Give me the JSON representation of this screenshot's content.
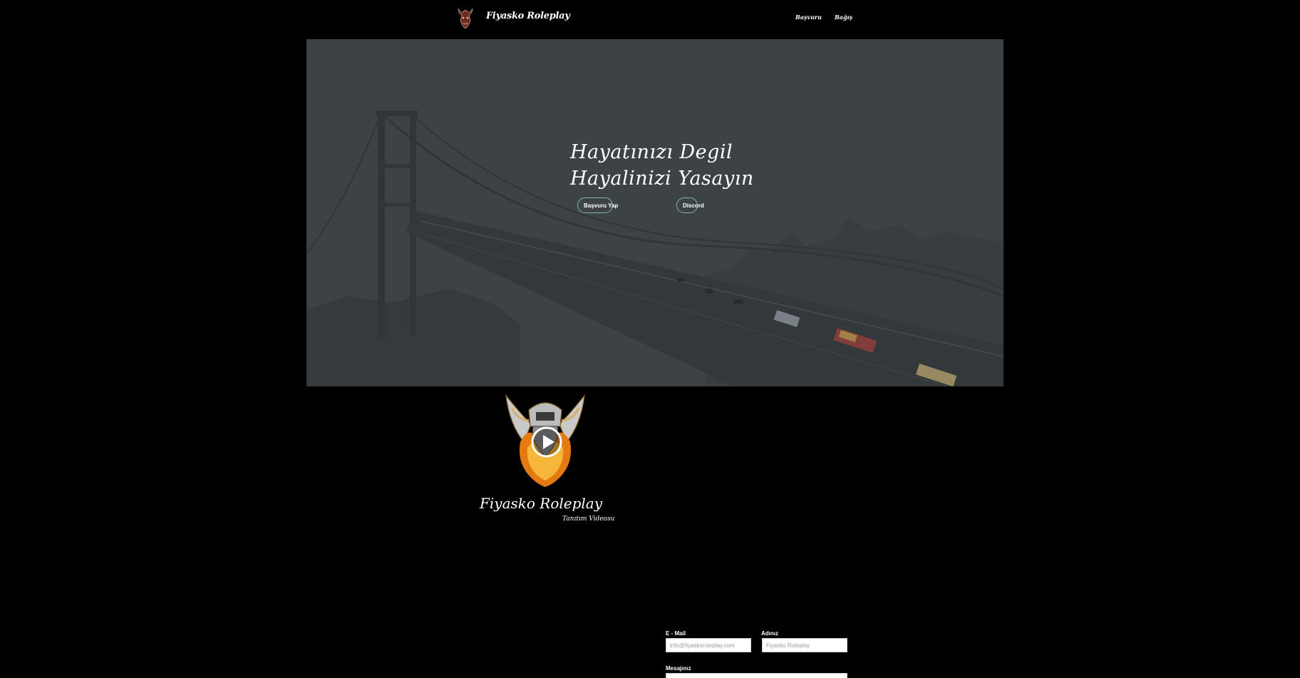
{
  "navbar": {
    "brand_name": "Fiyasko Roleplay",
    "links": [
      {
        "label": "Başvuru"
      },
      {
        "label": "Bağış"
      }
    ]
  },
  "hero": {
    "title_line1": "Hayatınızı Degil",
    "title_line2": "Hayalinizi Yasayın",
    "buttons": {
      "apply": "Başvuru Yap",
      "discord": "Discord"
    }
  },
  "video": {
    "title": "Fiyasko Roleplay",
    "subtitle": "Tanıtım Videosu"
  },
  "contact_form": {
    "email_label": "E - Mail",
    "email_placeholder": "info@fiyaskoroleplay.com",
    "name_label": "Adınız",
    "name_placeholder": "Fiyasko Roleplay",
    "message_label": "Mesajınız"
  },
  "colors": {
    "background": "#000000",
    "hero_overlay": "#3c4146",
    "button_border": "#7dbb92"
  }
}
